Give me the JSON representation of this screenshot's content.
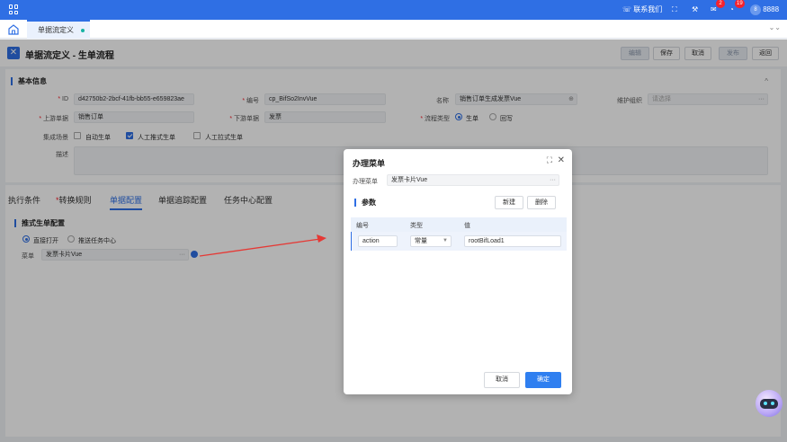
{
  "topbar": {
    "contact": "联系我们",
    "mail_badge": "2",
    "task_badge": "19",
    "user_avatar": "8",
    "user_name": "8888"
  },
  "tabs": [
    {
      "label": "单据流定义"
    }
  ],
  "header": {
    "title": "单据流定义 - 生单流程",
    "buttons": {
      "edit": "编辑",
      "save": "保存",
      "cancel": "取消",
      "publish": "发布",
      "back": "返回"
    }
  },
  "basic": {
    "section_title": "基本信息",
    "id_label": "ID",
    "id_value": "d42750b2-2bcf-41fb-bb55-e659823ae",
    "code_label": "编号",
    "code_value": "cp_BifSo2InvVue",
    "name_label": "名称",
    "name_value": "销售订单生成发票Vue",
    "org_label": "维护组织",
    "org_placeholder": "请选择",
    "upstream_label": "上游单据",
    "upstream_value": "销售订单",
    "downstream_label": "下游单据",
    "downstream_value": "发票",
    "flowtype_label": "流程类型",
    "flowtype_options": [
      "生单",
      "回写"
    ],
    "scene_label": "集成场景",
    "scene_options": [
      "自动生单",
      "人工推式生单",
      "人工拉式生单"
    ],
    "desc_label": "描述"
  },
  "lower": {
    "tabs": [
      "执行条件",
      "转换规则",
      "单据配置",
      "单据追踪配置",
      "任务中心配置"
    ],
    "section_title": "推式生单配置",
    "open_options": [
      "直接打开",
      "推送任务中心"
    ],
    "menu_label": "菜单",
    "menu_value": "发票卡片Vue"
  },
  "dialog": {
    "title": "办理菜单",
    "menu_label": "办理菜单",
    "menu_value": "发票卡片Vue",
    "params_title": "参数",
    "new_button": "新建",
    "delete_button": "删除",
    "columns": [
      "编号",
      "类型",
      "值"
    ],
    "row": {
      "code": "action",
      "type": "常量",
      "value": "rootBifLoad1"
    },
    "cancel_button": "取消",
    "ok_button": "确定"
  }
}
